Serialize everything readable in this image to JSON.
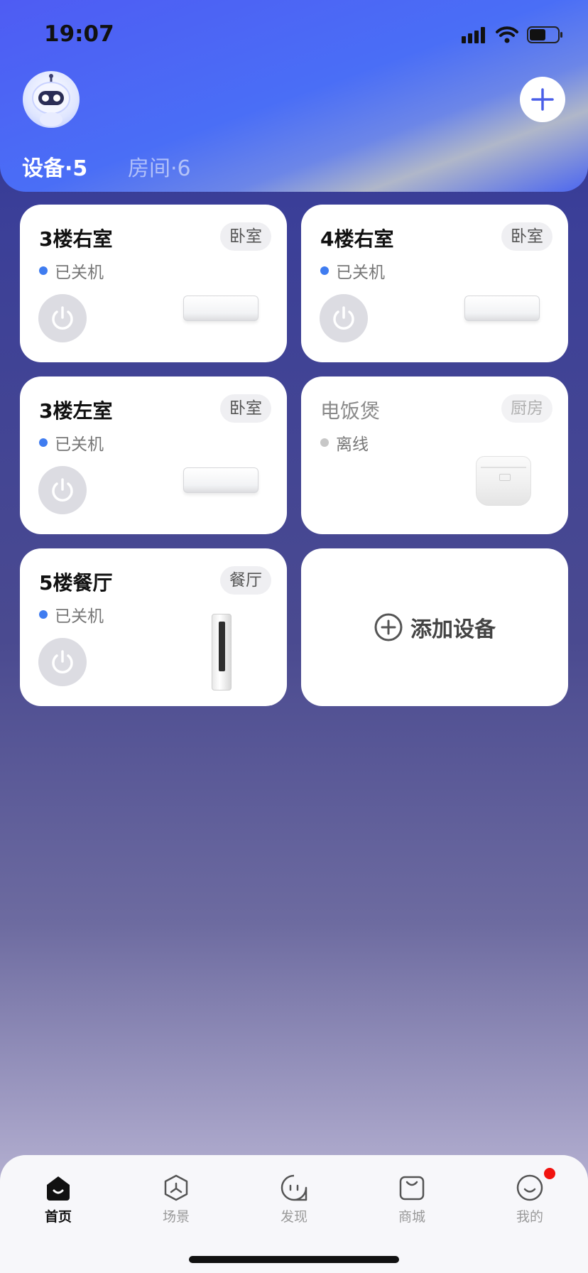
{
  "status_bar": {
    "time": "19:07"
  },
  "header": {
    "tabs": [
      {
        "label": "设备·5",
        "active": true
      },
      {
        "label": "房间·6",
        "active": false
      }
    ],
    "add_icon": "plus-icon",
    "avatar_icon": "robot-avatar-icon"
  },
  "devices": [
    {
      "name": "3楼右室",
      "room": "卧室",
      "status": "已关机",
      "status_color": "#3f7cf0",
      "type": "wall-ac"
    },
    {
      "name": "4楼右室",
      "room": "卧室",
      "status": "已关机",
      "status_color": "#3f7cf0",
      "type": "wall-ac"
    },
    {
      "name": "3楼左室",
      "room": "卧室",
      "status": "已关机",
      "status_color": "#3f7cf0",
      "type": "wall-ac"
    },
    {
      "name": "电饭煲",
      "room": "厨房",
      "status": "离线",
      "status_color": "#c7c7c7",
      "type": "rice-cooker"
    },
    {
      "name": "5楼餐厅",
      "room": "餐厅",
      "status": "已关机",
      "status_color": "#3f7cf0",
      "type": "floor-ac"
    }
  ],
  "add_device": {
    "label": "添加设备"
  },
  "bottom_nav": [
    {
      "label": "首页",
      "icon": "home-icon",
      "active": true
    },
    {
      "label": "场景",
      "icon": "scene-icon",
      "active": false
    },
    {
      "label": "发现",
      "icon": "discover-icon",
      "active": false
    },
    {
      "label": "商城",
      "icon": "shop-icon",
      "active": false
    },
    {
      "label": "我的",
      "icon": "profile-icon",
      "active": false,
      "badge": true
    }
  ]
}
